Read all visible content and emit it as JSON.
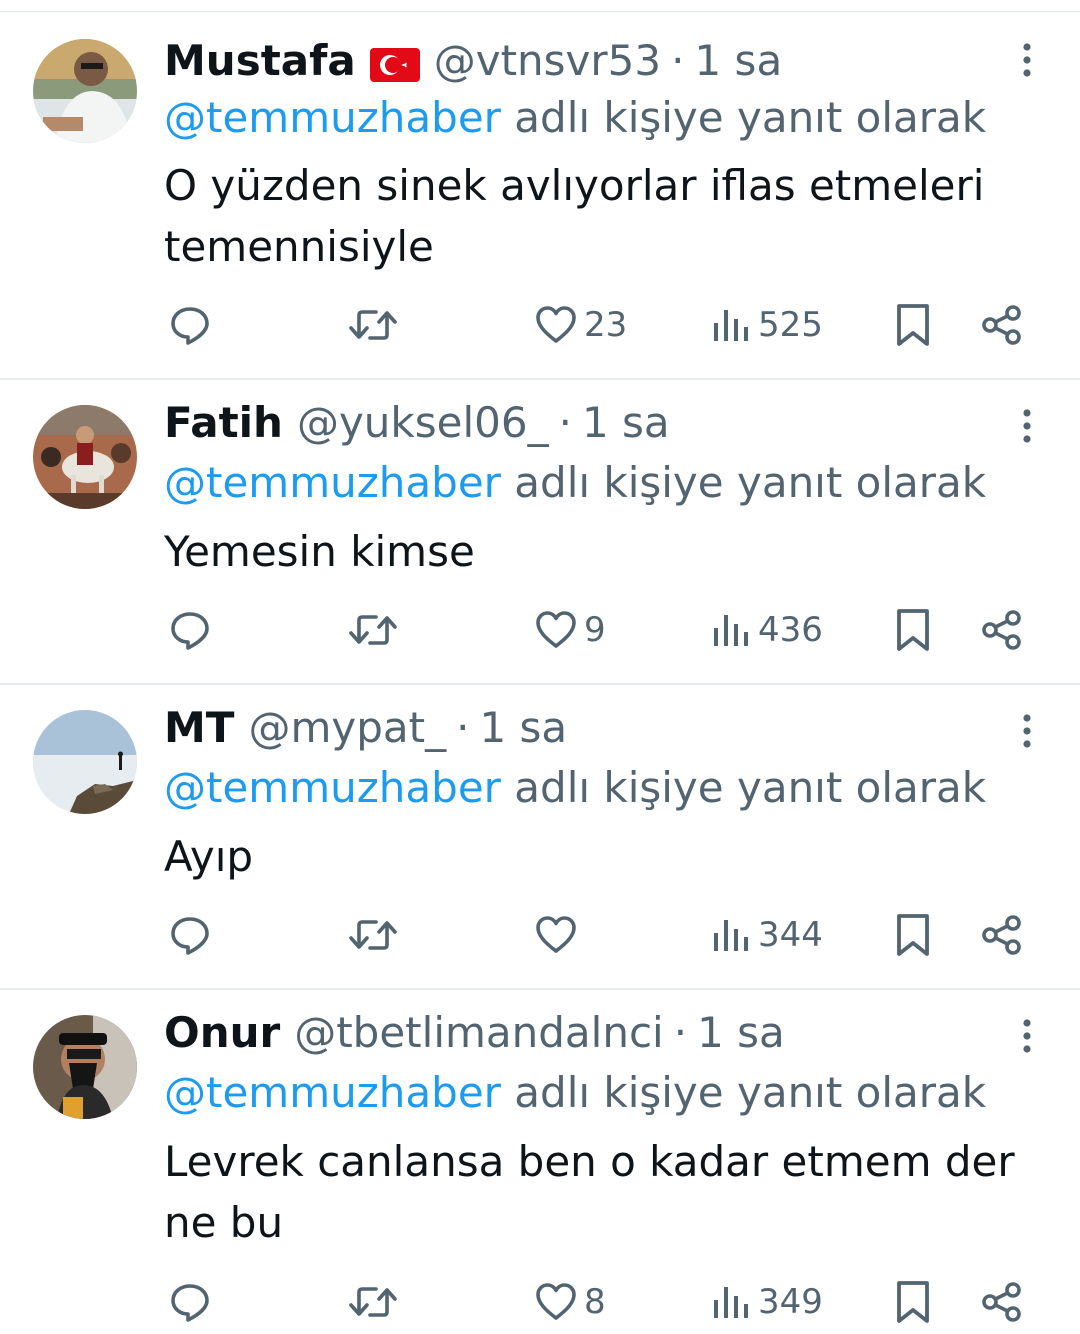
{
  "replies": [
    {
      "name": "Mustafa",
      "flag": "turkey-flag",
      "handle": "@vtnsvr53",
      "separator": "·",
      "time": "1 sa",
      "reply_mention": "@temmuzhaber",
      "reply_suffix": "adlı kişiye yanıt olarak",
      "text": "O yüzden sinek avlıyorlar iflas etmeleri temennisiyle",
      "likes": "23",
      "views": "525"
    },
    {
      "name": "Fatih",
      "handle": "@yuksel06_",
      "separator": "·",
      "time": "1 sa",
      "reply_mention": "@temmuzhaber",
      "reply_suffix": "adlı kişiye yanıt olarak",
      "text": "Yemesin kimse",
      "likes": "9",
      "views": "436"
    },
    {
      "name": "MT",
      "handle": "@mypat_",
      "separator": "·",
      "time": "1 sa",
      "reply_mention": "@temmuzhaber",
      "reply_suffix": "adlı kişiye yanıt olarak",
      "text": "Ayıp",
      "likes": "",
      "views": "344"
    },
    {
      "name": "Onur",
      "handle": "@tbetlimandalnci",
      "separator": "·",
      "time": "1 sa",
      "reply_mention": "@temmuzhaber",
      "reply_suffix": "adlı kişiye yanıt olarak",
      "text": "Levrek canlansa ben o kadar etmem der ne bu",
      "likes": "8",
      "views": "349"
    }
  ],
  "icons": {
    "reply": "reply-icon",
    "retweet": "retweet-icon",
    "like": "heart-icon",
    "views": "views-icon",
    "bookmark": "bookmark-icon",
    "share": "share-icon",
    "more": "more-vertical-icon"
  },
  "colors": {
    "text": "#0f1419",
    "secondary": "#536471",
    "link": "#1d9bf0",
    "divider": "#e8ecef"
  }
}
